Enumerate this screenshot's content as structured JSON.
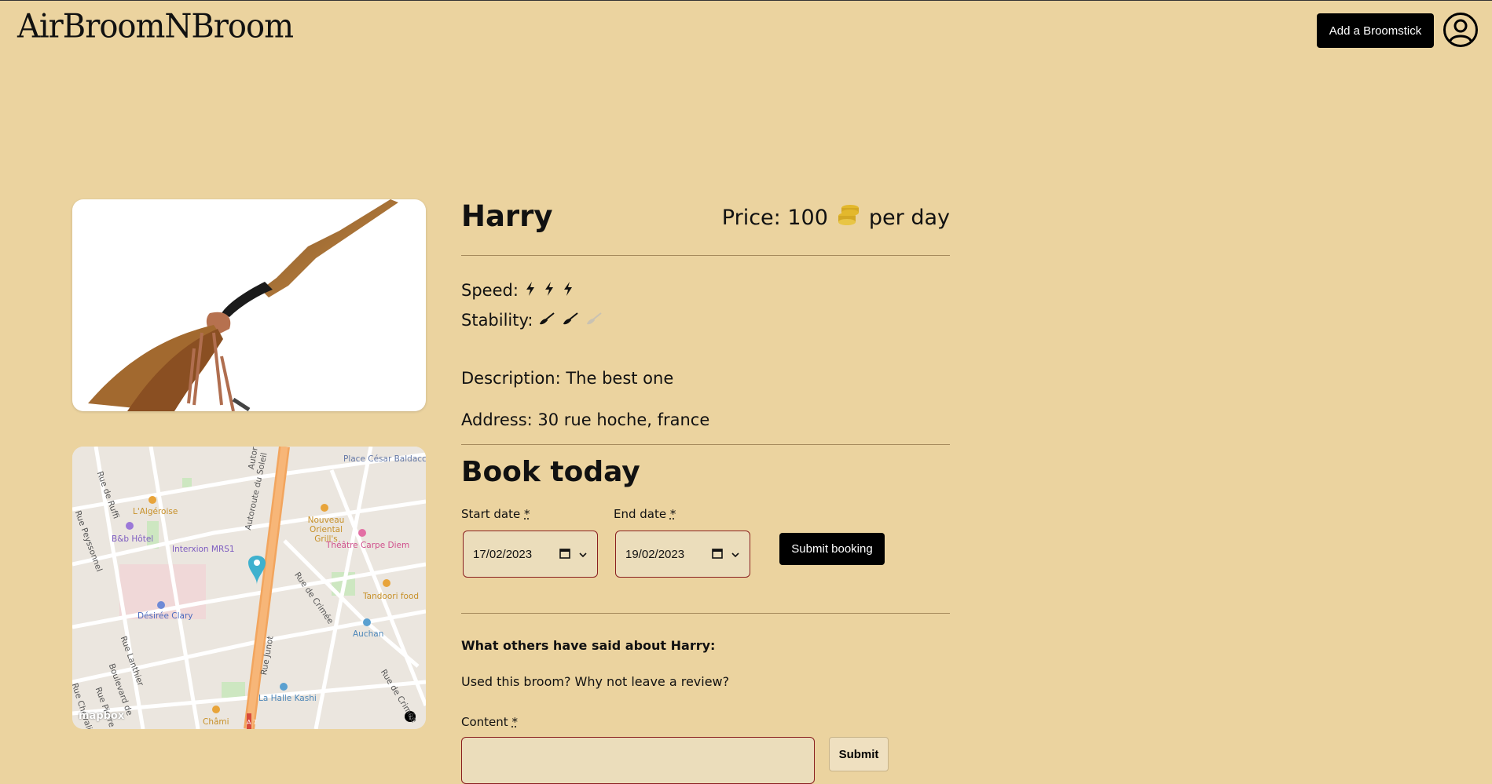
{
  "header": {
    "logo": "AirBroomNBroom",
    "add_button": "Add a Broomstick"
  },
  "broom": {
    "name": "Harry",
    "price_label": "Price: 100",
    "price_suffix": "per day",
    "speed_label": "Speed:",
    "speed_rating": 3,
    "speed_max": 3,
    "stability_label": "Stability:",
    "stability_rating": 2,
    "stability_max": 3,
    "description": "Description: The best one",
    "address": "Address: 30 rue hoche, france"
  },
  "booking": {
    "title": "Book today",
    "start_label": "Start date",
    "end_label": "End date",
    "required_mark": "*",
    "start_value": "17/02/2023",
    "end_value": "19/02/2023",
    "submit": "Submit booking"
  },
  "reviews": {
    "heading": "What others have said about Harry:",
    "prompt": "Used this broom? Why not leave a review?",
    "content_label": "Content",
    "submit": "Submit"
  },
  "map": {
    "labels": [
      "Place César Baldaccini",
      "L'Algéroise",
      "Nouveau Oriental Grill's",
      "Théâtre Carpe Diem",
      "B&b Hôtel",
      "Interxion MRS1",
      "Tandoori food",
      "Désirée Clary",
      "Auchan",
      "La Halle Kashi",
      "Châmi",
      "Autoroute du Soleil",
      "Rue de Crimée",
      "Rue Junot",
      "Rue de Ruffi",
      "Rue Peyssonnel",
      "Rue Lanthier",
      "Boulevard de",
      "Rue Pierre",
      "Rue Chevalier",
      "Rue de Crimée",
      "Autor",
      "A 7",
      "mapbox"
    ]
  },
  "colors": {
    "background": "#ebd39f",
    "primary": "#000000",
    "field_border": "#8a1f1f",
    "coin": "#d4a824"
  }
}
